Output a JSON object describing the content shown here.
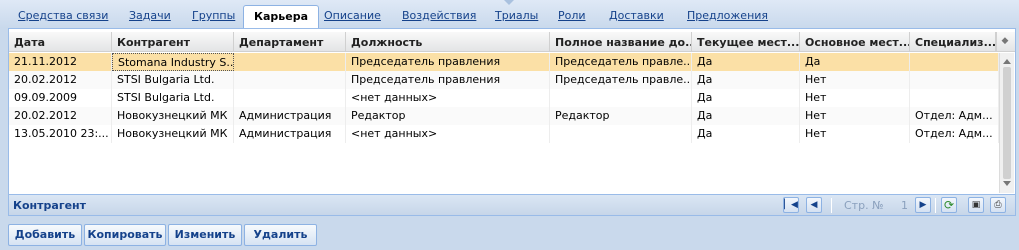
{
  "tabs": [
    {
      "label": "Средства связи"
    },
    {
      "label": "Задачи"
    },
    {
      "label": "Группы"
    },
    {
      "label": "Карьера"
    },
    {
      "label": "Описание"
    },
    {
      "label": "Воздействия"
    },
    {
      "label": "Триалы"
    },
    {
      "label": "Роли"
    },
    {
      "label": "Доставки"
    },
    {
      "label": "Предложения"
    }
  ],
  "grid": {
    "columns": [
      "Дата",
      "Контрагент",
      "Департамент",
      "Должность",
      "Полное название до...",
      "Текущее мест...",
      "Основное мест...",
      "Специализ..."
    ],
    "rows": [
      [
        "21.11.2012",
        "Stomana Industry S...",
        "",
        "Председатель правления",
        "Председатель правле...",
        "Да",
        "Да",
        ""
      ],
      [
        "20.02.2012",
        "STSI Bulgaria Ltd.",
        "",
        "Председатель правления",
        "Председатель правле...",
        "Да",
        "Нет",
        ""
      ],
      [
        "09.09.2009",
        "STSI Bulgaria Ltd.",
        "",
        "<нет данных>",
        "",
        "Да",
        "Нет",
        ""
      ],
      [
        "20.02.2012",
        "Новокузнецкий МК",
        "Администрация",
        "Редактор",
        "Редактор",
        "Да",
        "Нет",
        "Отдел: Адм..."
      ],
      [
        "13.05.2010 23:...",
        "Новокузнецкий МК",
        "Администрация",
        "<нет данных>",
        "",
        "Да",
        "Нет",
        "Отдел: Адм..."
      ]
    ],
    "selected_row": 0
  },
  "footer": {
    "title": "Контрагент",
    "page_label": "Стр. №",
    "page_number": "1"
  },
  "icons": {
    "first": "first-page-icon",
    "prev": "prev-page-icon",
    "next": "next-page-icon",
    "refresh": "refresh-icon",
    "save": "save-icon",
    "print": "print-icon"
  },
  "actions": {
    "add": "Добавить",
    "copy": "Копировать",
    "edit": "Изменить",
    "delete": "Удалить"
  },
  "colors": {
    "selected_row": "#fbe0a6",
    "tab_link": "#15428b",
    "background": "#c9d9ec"
  }
}
